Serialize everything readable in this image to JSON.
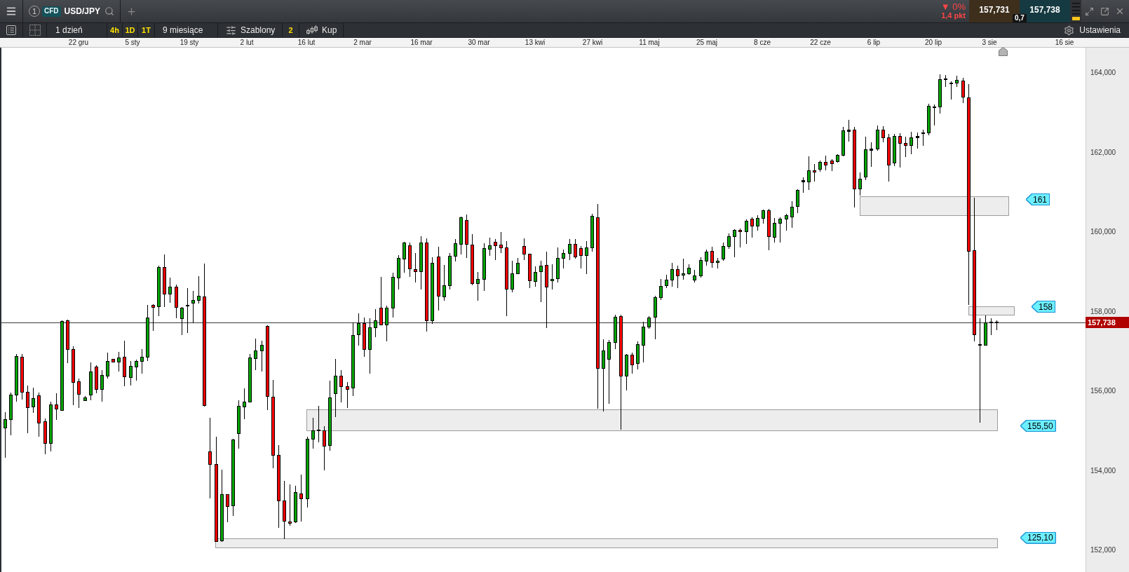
{
  "top_bar": {
    "tab": {
      "number": "1",
      "badge": "CFD",
      "symbol": "USD/JPY"
    },
    "change": "▼ 0%",
    "change_points": "1,4 pkt",
    "sell_price": "157,731",
    "buy_price": "157,738",
    "spread": "0,7"
  },
  "chart_toolbar": {
    "interval": "1 dzień",
    "interval_shortcuts": [
      "4h",
      "1D",
      "1T"
    ],
    "range": "9 miesiące",
    "templates": "Szablony",
    "templates_count": "2",
    "price_side": "Kup",
    "settings": "Ustawienia"
  },
  "date_axis": {
    "labels": [
      "22 gru",
      "5 sty",
      "19 sty",
      "2 lut",
      "16 lut",
      "2 mar",
      "16 mar",
      "30 mar",
      "13 kwi",
      "27 kwi",
      "11 maj",
      "25 maj",
      "8 cze",
      "22 cze",
      "6 lip",
      "20 lip",
      "3 sie",
      "16 sie"
    ]
  },
  "price_axis": {
    "labels": [
      "164,000",
      "162,000",
      "160,000",
      "158,000",
      "156,000",
      "154,000",
      "152,000"
    ],
    "current_price": "157,738"
  },
  "levels": [
    {
      "label": "161"
    },
    {
      "label": "158"
    },
    {
      "label": "155,50"
    },
    {
      "label": "125,10"
    }
  ]
}
